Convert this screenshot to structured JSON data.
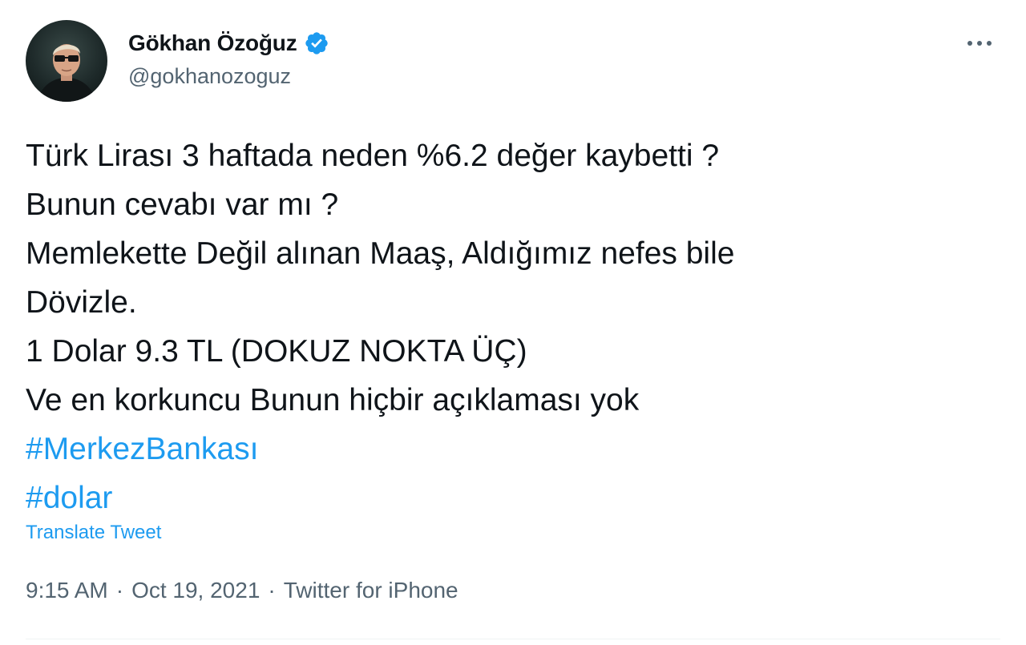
{
  "author": {
    "display_name": "Gökhan Özoğuz",
    "handle": "@gokhanozoguz",
    "verified": true,
    "avatar_icon": "profile-photo-man-sunglasses"
  },
  "tweet": {
    "lines": [
      "Türk Lirası 3 haftada neden %6.2 değer kaybetti ?",
      "Bunun cevabı var mı ?",
      "Memlekette Değil alınan Maaş, Aldığımız nefes bile",
      "Dövizle.",
      "1 Dolar 9.3 TL (DOKUZ NOKTA ÜÇ)",
      "Ve en korkuncu Bunun hiçbir açıklaması yok"
    ],
    "hashtags": [
      "#MerkezBankası",
      "#dolar"
    ],
    "translate_label": "Translate Tweet"
  },
  "meta": {
    "time": "9:15 AM",
    "separator": "·",
    "date": "Oct 19, 2021",
    "source": "Twitter for iPhone"
  },
  "colors": {
    "accent": "#1d9bf0",
    "text": "#0f1419",
    "muted": "#536471"
  },
  "icons": {
    "verified": "verified-badge-icon",
    "more": "more-options-icon"
  }
}
